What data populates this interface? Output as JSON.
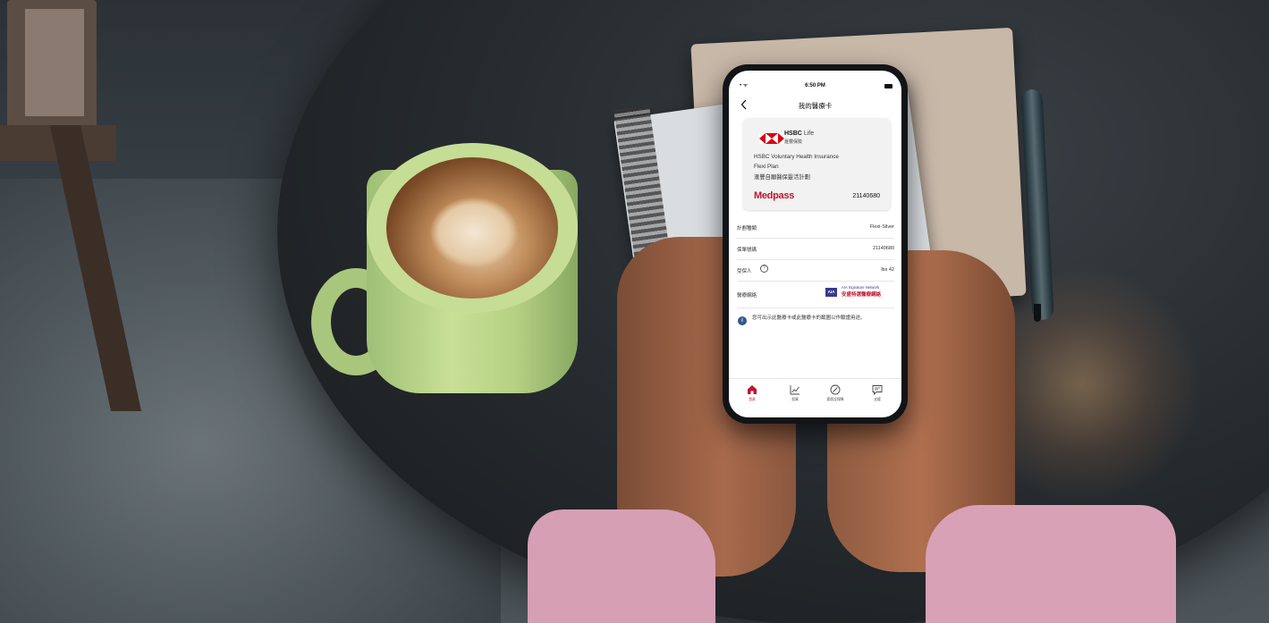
{
  "phone_screen": {
    "status": {
      "time": "6:50 PM",
      "left": "• ᯤ"
    },
    "nav": {
      "title": "我的醫療卡"
    },
    "card": {
      "brand": "HSBC",
      "brand_suffix": "Life",
      "brand_chinese": "滙豐保險",
      "line1": "HSBC Voluntary Health Insurance",
      "line2": "Flexi Plan",
      "line3": "滙豐自願醫保靈活計劃",
      "medpass": "Medpass",
      "number": "21140680"
    },
    "rows": [
      {
        "label": "計劃種類",
        "value": "Flexi-Silver"
      },
      {
        "label": "保單號碼",
        "value": "21140680"
      },
      {
        "label": "受保人",
        "value": "lbs 42"
      },
      {
        "label": "醫療網絡",
        "network_en": "AIA Signature Network",
        "network_zh": "安盛特選醫療網絡",
        "network_mark": "AIA"
      }
    ],
    "notice": "您可出示此醫療卡或此醫療卡的截圖以作驗證用途。",
    "tabs": [
      {
        "label": "首頁",
        "icon": "home-icon"
      },
      {
        "label": "投資",
        "icon": "chart-icon"
      },
      {
        "label": "索償及保障",
        "icon": "compass-icon"
      },
      {
        "label": "支援",
        "icon": "chat-icon"
      }
    ]
  },
  "colors": {
    "hsbc_red": "#db0011",
    "tab_active": "#c2142d",
    "info_blue": "#30598a"
  }
}
